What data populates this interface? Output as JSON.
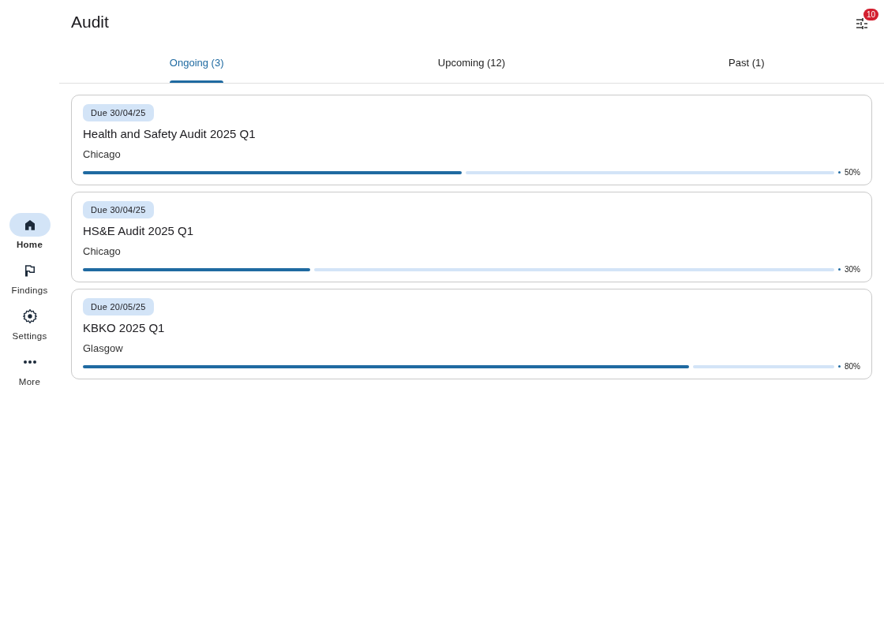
{
  "header": {
    "title": "Audit",
    "filter_badge": "10"
  },
  "nav": [
    {
      "label": "Home",
      "kind": "home",
      "selected": true
    },
    {
      "label": "Findings",
      "kind": "flag",
      "selected": false
    },
    {
      "label": "Settings",
      "kind": "gear",
      "selected": false
    },
    {
      "label": "More",
      "kind": "more",
      "selected": false
    }
  ],
  "tabs": [
    {
      "label": "Ongoing (3)",
      "selected": true
    },
    {
      "label": "Upcoming (12)",
      "selected": false
    },
    {
      "label": "Past (1)",
      "selected": false
    }
  ],
  "audits": [
    {
      "due": "Due 30/04/25",
      "title": "Health and Safety Audit 2025 Q1",
      "location": "Chicago",
      "level": 0.5,
      "reading": "50%"
    },
    {
      "due": "Due 30/04/25",
      "title": "HS&E Audit 2025 Q1",
      "location": "Chicago",
      "level": 0.3,
      "reading": "30%"
    },
    {
      "due": "Due 20/05/25",
      "title": "KBKO 2025 Q1",
      "location": "Glasgow",
      "level": 0.8,
      "reading": "80%"
    }
  ]
}
